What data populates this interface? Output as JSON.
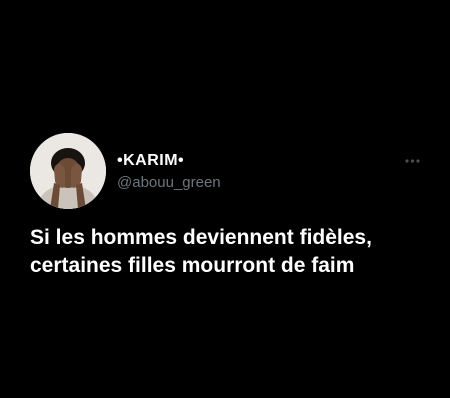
{
  "theme": {
    "background": "#000000",
    "text_primary": "#ffffff",
    "text_secondary": "#6e767d"
  },
  "tweet": {
    "author": {
      "display_name": "•KARIM•",
      "handle": "@abouu_green",
      "avatar_icon": "profile-photo"
    },
    "more_icon": "more-horizontal-icon",
    "text_lines": [
      "Si les hommes deviennent fidèles,",
      "certaines filles mourront de faim"
    ]
  }
}
